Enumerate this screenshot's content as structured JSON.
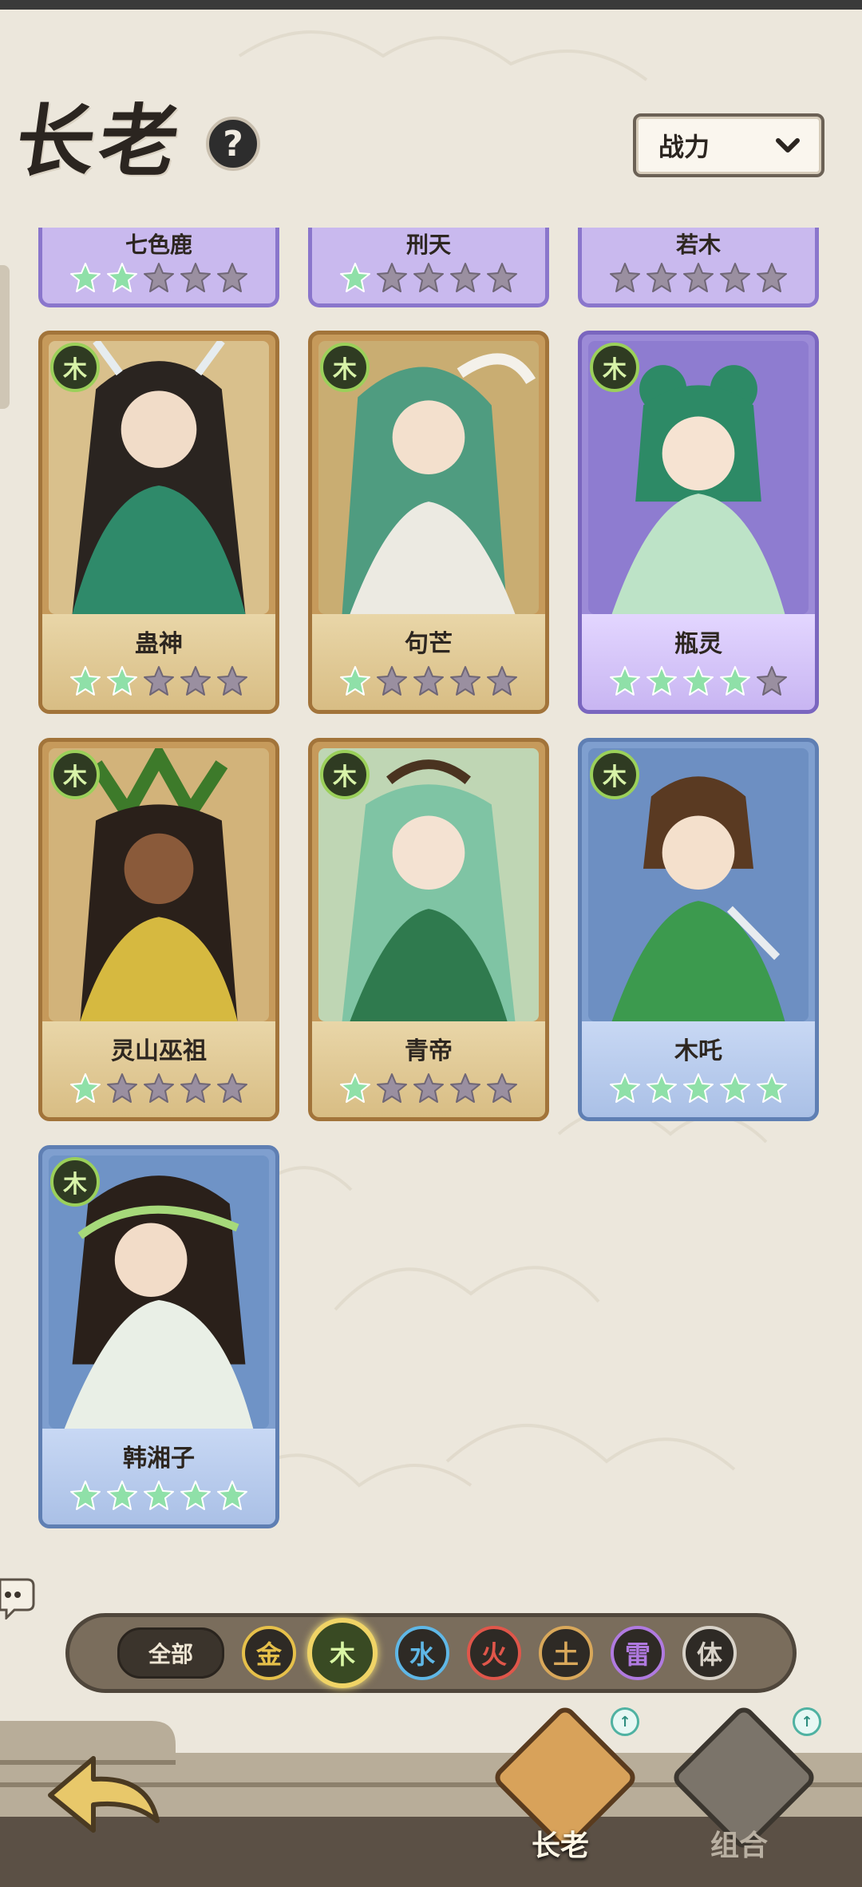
{
  "header": {
    "title": "长老",
    "help_label": "?",
    "sort_label": "战力"
  },
  "colors": {
    "star_on": "#8fe0a8",
    "star_off": "#9a8fa0",
    "wood_ring": "#9bd05a"
  },
  "top_strip": [
    {
      "name": "七色鹿",
      "stars_on": 2
    },
    {
      "name": "刑天",
      "stars_on": 1
    },
    {
      "name": "若木",
      "stars_on": 0
    }
  ],
  "cards": [
    {
      "name": "蛊神",
      "element": "木",
      "frame": "gold",
      "stars_on": 2
    },
    {
      "name": "句芒",
      "element": "木",
      "frame": "gold",
      "stars_on": 1
    },
    {
      "name": "瓶灵",
      "element": "木",
      "frame": "purple",
      "stars_on": 4
    },
    {
      "name": "灵山巫祖",
      "element": "木",
      "frame": "gold",
      "stars_on": 1
    },
    {
      "name": "青帝",
      "element": "木",
      "frame": "gold",
      "stars_on": 1
    },
    {
      "name": "木吒",
      "element": "木",
      "frame": "blue",
      "stars_on": 5
    },
    {
      "name": "韩湘子",
      "element": "木",
      "frame": "blue",
      "stars_on": 5
    }
  ],
  "filters": {
    "all_label": "全部",
    "elements": [
      {
        "label": "金",
        "color": "#e6c04a",
        "active": false
      },
      {
        "label": "木",
        "color": "#9bd05a",
        "active": true
      },
      {
        "label": "水",
        "color": "#5fb7e6",
        "active": false
      },
      {
        "label": "火",
        "color": "#e0564a",
        "active": false
      },
      {
        "label": "土",
        "color": "#d9a85a",
        "active": false
      },
      {
        "label": "雷",
        "color": "#b07ae0",
        "active": false
      },
      {
        "label": "体",
        "color": "#d8d2c8",
        "active": false
      }
    ]
  },
  "nav": {
    "elders_label": "长老",
    "combo_label": "组合"
  }
}
